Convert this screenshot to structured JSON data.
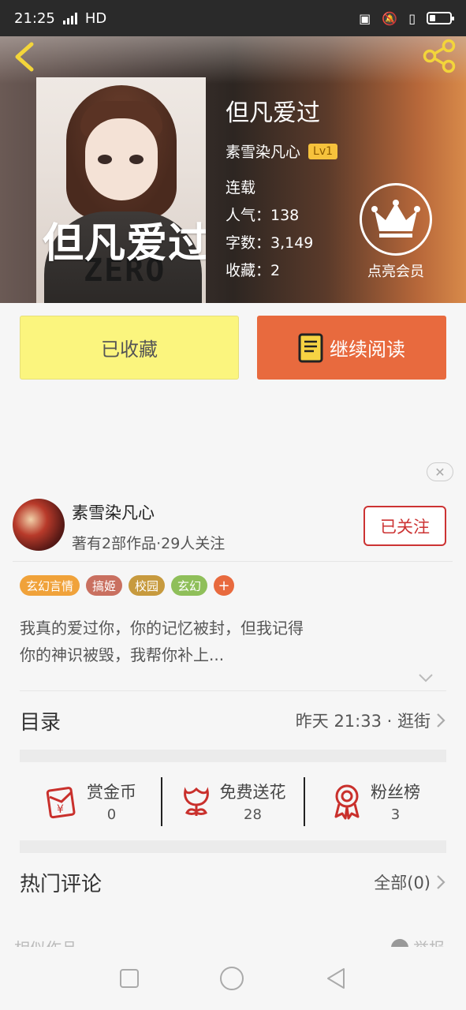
{
  "status_bar": {
    "time": "21:25",
    "network": "HD",
    "network_type": "4G",
    "icons": [
      "nfc-icon",
      "silent-icon",
      "vibrate-icon",
      "battery-icon"
    ]
  },
  "header": {
    "back_icon": "back-chevron-icon",
    "share_icon": "share-icon"
  },
  "book": {
    "cover_title": "但凡爱过",
    "cover_shirt_text": "ZERO",
    "title": "但凡爱过",
    "author": "素雪染凡心",
    "level": "Lv1",
    "status": "连载",
    "popularity": "人气：138",
    "word_count": "字数：3,149",
    "favorites": "收藏：2"
  },
  "vip": {
    "icon": "crown-icon",
    "label": "点亮会员"
  },
  "actions": {
    "collected_label": "已收藏",
    "read_label": "继续阅读",
    "read_icon": "book-icon"
  },
  "author_card": {
    "name": "素雪染凡心",
    "subtitle": "著有2部作品·29人关注",
    "follow_label": "已关注"
  },
  "tags": [
    {
      "label": "玄幻言情",
      "color": "#f0a23a"
    },
    {
      "label": "搞姬",
      "color": "#c97060"
    },
    {
      "label": "校园",
      "color": "#c79a3e"
    },
    {
      "label": "玄幻",
      "color": "#8fbf5a"
    }
  ],
  "tag_more": "+",
  "description": {
    "line1": "我真的爱过你，你的记忆被封，但我记得",
    "line2": "你的神识被毁，我帮你补上..."
  },
  "catalog": {
    "title": "目录",
    "update_info": "昨天 21:33 · 逛街"
  },
  "stats": [
    {
      "label": "赏金币",
      "value": "0",
      "icon": "red-envelope-icon"
    },
    {
      "label": "免费送花",
      "value": "28",
      "icon": "flower-icon"
    },
    {
      "label": "粉丝榜",
      "value": "3",
      "icon": "medal-icon"
    }
  ],
  "comments": {
    "title": "热门评论",
    "all_label": "全部(0)"
  },
  "footer": {
    "similar": "相似作品",
    "report": "举报"
  },
  "colors": {
    "accent_orange": "#e86a3e",
    "collected_yellow": "#fbf57e",
    "follow_red": "#cc3333",
    "icon_red": "#c9302c"
  }
}
